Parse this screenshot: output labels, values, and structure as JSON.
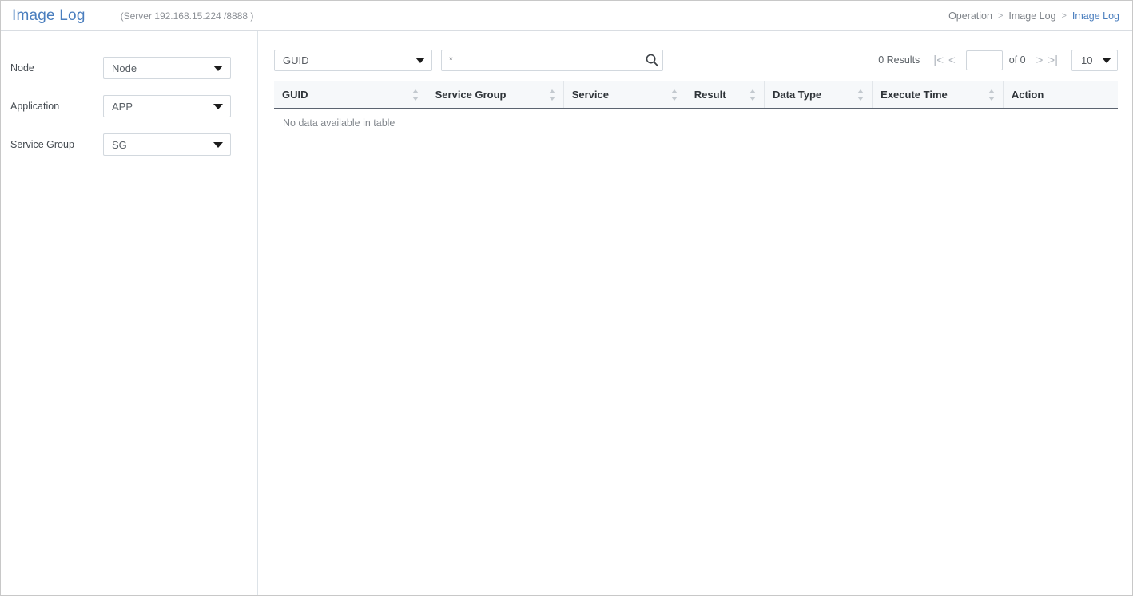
{
  "header": {
    "title": "Image Log",
    "server_info": "(Server  192.168.15.224 /8888 )",
    "breadcrumb": [
      {
        "label": "Operation",
        "active": false
      },
      {
        "label": "Image Log",
        "active": false
      },
      {
        "label": "Image Log",
        "active": true
      }
    ],
    "breadcrumb_separator": ">",
    "title_color": "#4a7ebe"
  },
  "sidebar": {
    "filters": [
      {
        "label": "Node",
        "value": "Node",
        "name": "node"
      },
      {
        "label": "Application",
        "value": "APP",
        "name": "application"
      },
      {
        "label": "Service Group",
        "value": "SG",
        "name": "service-group"
      }
    ]
  },
  "toolbar": {
    "field_select": {
      "value": "GUID"
    },
    "search": {
      "value": "*",
      "placeholder": "",
      "icon": "search-icon"
    }
  },
  "pagination": {
    "results_label": "0 Results",
    "first_icon": "|<",
    "prev_icon": "<",
    "page_value": "",
    "of_label": "of 0",
    "next_icon": ">",
    "last_icon": ">|",
    "page_size": "10"
  },
  "table": {
    "columns": [
      {
        "label": "GUID",
        "sortable": true
      },
      {
        "label": "Service  Group",
        "sortable": true
      },
      {
        "label": "Service",
        "sortable": true
      },
      {
        "label": "Result",
        "sortable": true
      },
      {
        "label": "Data  Type",
        "sortable": true
      },
      {
        "label": "Execute  Time",
        "sortable": true
      },
      {
        "label": "Action",
        "sortable": false
      }
    ],
    "empty_message": "No data available in table",
    "rows": []
  }
}
